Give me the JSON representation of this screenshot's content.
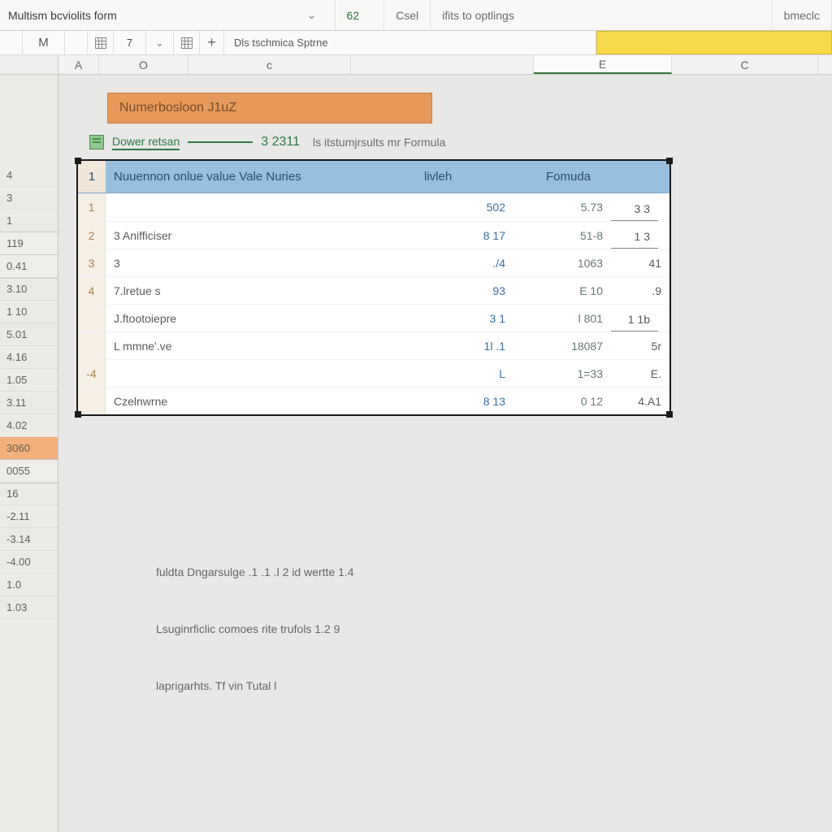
{
  "titlebar": {
    "doc_name": "Multism bcviolits form",
    "seg_num": "62",
    "seg_csl": "Csel",
    "seg_right_a": "ifits to optlings",
    "seg_right_b": "bmeclc"
  },
  "formula_bar": {
    "name_box": "M",
    "num": "7",
    "dropdown_glyph": "⌄",
    "plus_glyph": "+",
    "input": "Dls tschmica Sptrne",
    "tag": ""
  },
  "columns": [
    "A",
    "O",
    "c",
    "",
    "E",
    "C"
  ],
  "row_labels": [
    "4",
    "3",
    "1",
    "119",
    "0.41",
    "3.10",
    "1 10",
    "5.01",
    "4.16",
    "1.05",
    "3.11",
    "4.02",
    "3060",
    "0055",
    "16",
    "-2.11",
    "-3.14",
    "-4.00",
    "1.0",
    "1.03"
  ],
  "row_highlight_index": 12,
  "orange_title": "Numerbosloon J1uZ",
  "green": {
    "label": "Dower retsan",
    "num": "3 2311",
    "tail": "ls itstumjrsults mr Formula"
  },
  "table": {
    "headers": {
      "idx": "1",
      "label": "Nuuennon onlue value Vale Nuries",
      "val": "livleh",
      "form": "Fomuda"
    },
    "rows": [
      {
        "idx": "1",
        "label": "",
        "c": "502",
        "d": "5.73",
        "e": "3 3"
      },
      {
        "idx": "2",
        "label": "3 Anifficiser",
        "c": "8 17",
        "d": "51-8",
        "e": "1 3"
      },
      {
        "idx": "3",
        "label": "3",
        "c": "./4",
        "d": "1063",
        "e": "41"
      },
      {
        "idx": "4",
        "label": "7.lretue s",
        "c": "93",
        "d": "E 10",
        "e": ".9"
      },
      {
        "idx": "",
        "label": "J.ftootoiepre",
        "c": "3 1",
        "d": "l 801",
        "e": "1 1b"
      },
      {
        "idx": "",
        "label": "L mmne'.ve",
        "c": "1l .1",
        "d": "18087",
        "e": "5r"
      },
      {
        "idx": "-4",
        "label": "",
        "c": "L",
        "d": "1=33",
        "e": "E."
      },
      {
        "idx": "",
        "label": "Czelnwrne",
        "c": "8 13",
        "d": "0 12",
        "e": "4.A1"
      }
    ]
  },
  "notes": {
    "a": "fuldta Dngarsulge .1 .1  .l  2 id wertte  1.4",
    "b": "Lsuginrficlic comoes rite trufols 1.2 9",
    "c": "laprigarhts. Tf  vin Tutal l"
  }
}
